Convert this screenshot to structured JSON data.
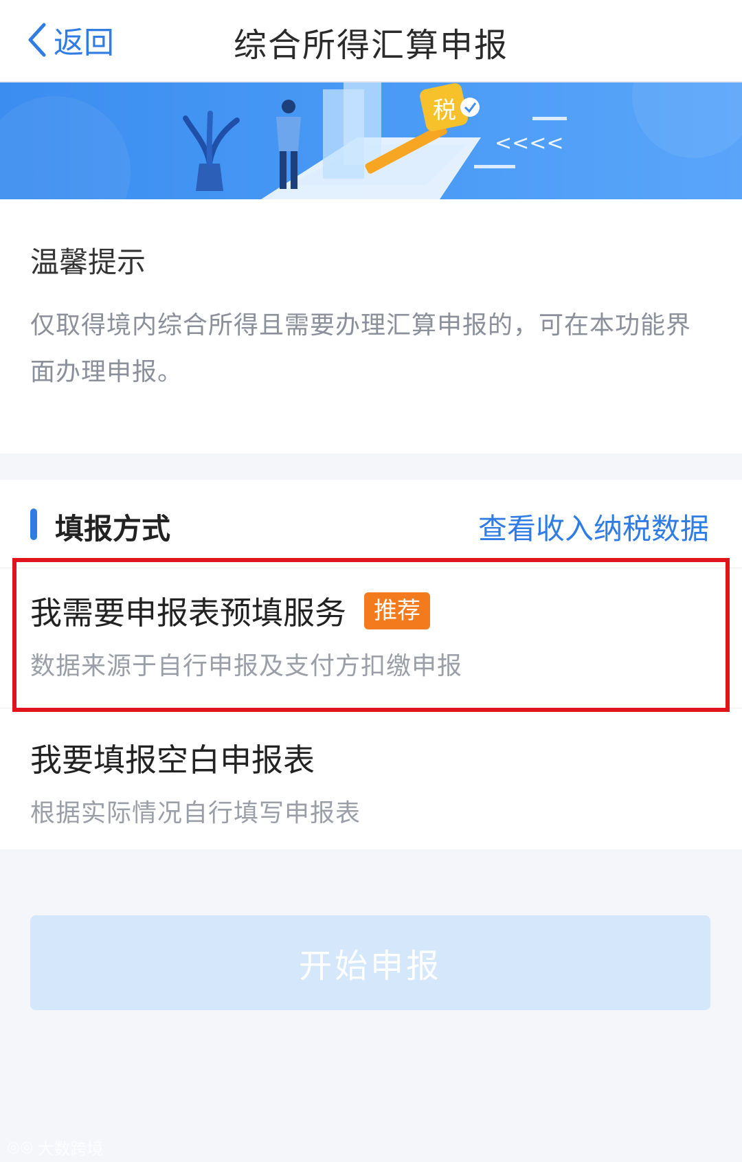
{
  "nav": {
    "back_label": "返回",
    "title": "综合所得汇算申报"
  },
  "banner": {
    "tax_char": "税",
    "arrows": "<<<<"
  },
  "tips": {
    "title": "温馨提示",
    "body": "仅取得境内综合所得且需要办理汇算申报的，可在本功能界面办理申报。"
  },
  "methods": {
    "section_title": "填报方式",
    "view_link": "查看收入纳税数据",
    "options": [
      {
        "title": "我需要申报表预填服务",
        "badge": "推荐",
        "subtitle": "数据来源于自行申报及支付方扣缴申报",
        "highlighted": true
      },
      {
        "title": "我要填报空白申报表",
        "subtitle": "根据实际情况自行填写申报表"
      }
    ]
  },
  "start_button": {
    "label": "开始申报",
    "disabled": true
  },
  "watermark": {
    "text": "大数跨境"
  },
  "colors": {
    "accent": "#2f7ce4",
    "badge": "#f37b1d",
    "highlight_border": "#e0141c",
    "button_disabled": "#d4e7fb"
  }
}
